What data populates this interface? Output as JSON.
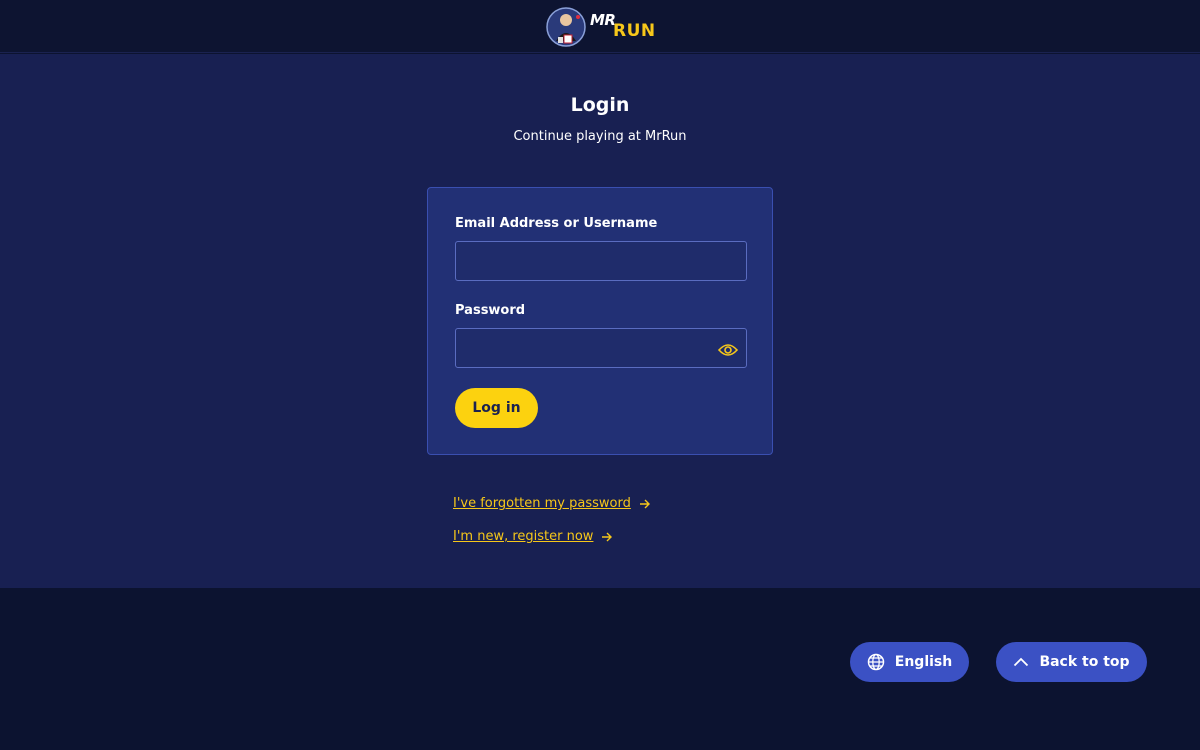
{
  "header": {
    "logo_alt": "MrRun",
    "logo_mr": "MR",
    "logo_run": "RUN"
  },
  "login": {
    "title": "Login",
    "subtitle": "Continue playing at MrRun",
    "email_label": "Email Address or Username",
    "email_value": "",
    "email_placeholder": "",
    "password_label": "Password",
    "password_value": "",
    "password_placeholder": "",
    "submit_label": "Log in"
  },
  "links": {
    "forgot": "I've forgotten my password",
    "register": "I'm new, register now"
  },
  "footer": {
    "language_label": "English",
    "back_to_top_label": "Back to top"
  },
  "colors": {
    "accent": "#fcd20f",
    "primary_bg": "#182052",
    "card_bg": "#223075",
    "pill_bg": "#3b51c4"
  },
  "icons": {
    "eye": "eye-icon",
    "globe": "globe-icon",
    "arrow": "arrow-right-icon",
    "chevron": "chevron-up-icon"
  }
}
